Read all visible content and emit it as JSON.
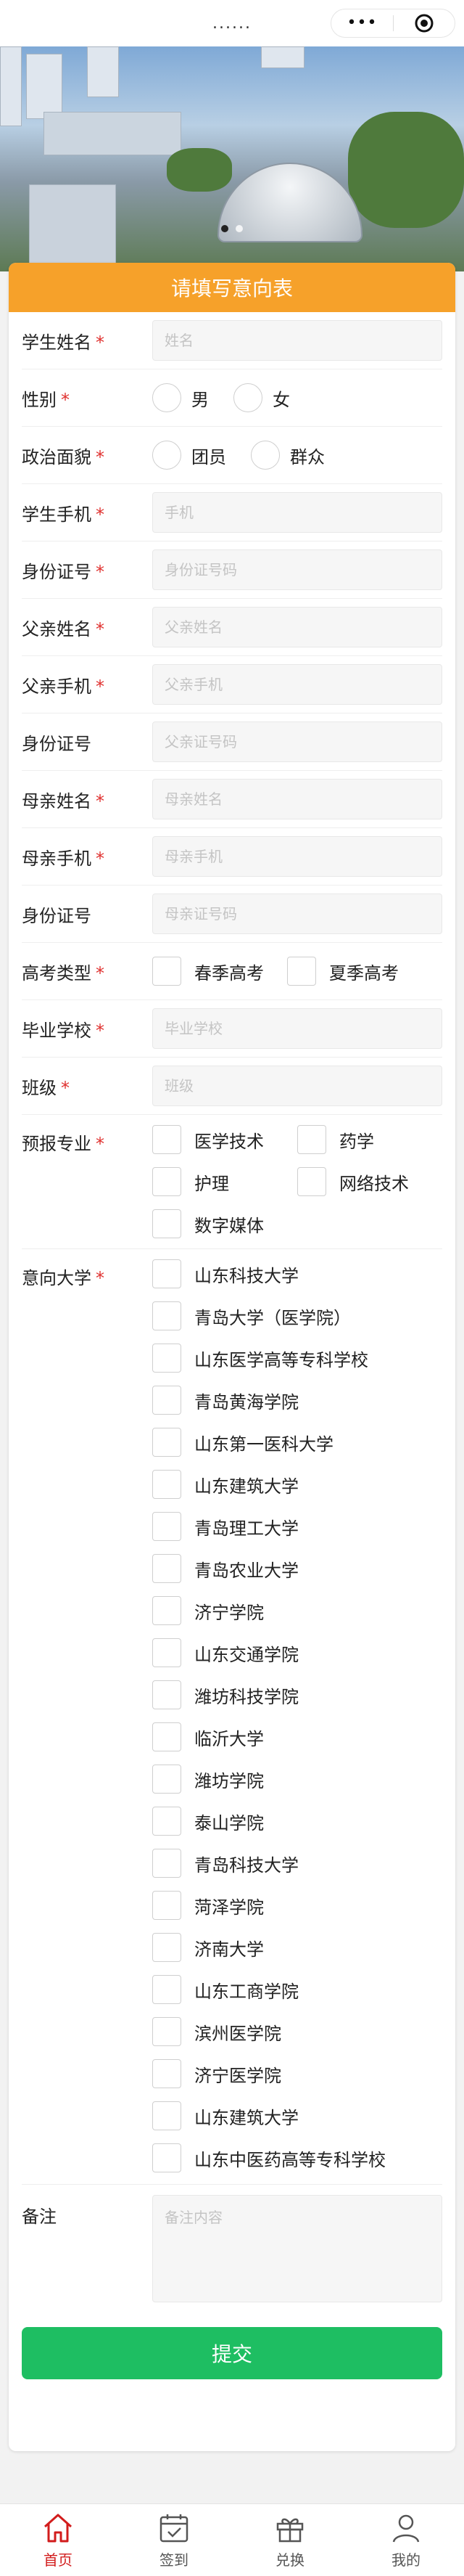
{
  "nav": {
    "title_dots": "......",
    "more_icon": "more-dots-icon",
    "close_icon": "record-circle-icon"
  },
  "banner": {
    "slides": 2,
    "active_slide": 1
  },
  "form": {
    "title": "请填写意向表",
    "required_mark": "*",
    "student_name": {
      "label": "学生姓名",
      "placeholder": "姓名",
      "value": ""
    },
    "gender": {
      "label": "性别",
      "options": [
        "男",
        "女"
      ]
    },
    "political": {
      "label": "政治面貌",
      "options": [
        "团员",
        "群众"
      ]
    },
    "student_phone": {
      "label": "学生手机",
      "placeholder": "手机",
      "value": ""
    },
    "id_card": {
      "label": "身份证号",
      "placeholder": "身份证号码",
      "value": ""
    },
    "father_name": {
      "label": "父亲姓名",
      "placeholder": "父亲姓名",
      "value": ""
    },
    "father_phone": {
      "label": "父亲手机",
      "placeholder": "父亲手机",
      "value": ""
    },
    "father_id": {
      "label": "身份证号",
      "placeholder": "父亲证号码",
      "value": ""
    },
    "mother_name": {
      "label": "母亲姓名",
      "placeholder": "母亲姓名",
      "value": ""
    },
    "mother_phone": {
      "label": "母亲手机",
      "placeholder": "母亲手机",
      "value": ""
    },
    "mother_id": {
      "label": "身份证号",
      "placeholder": "母亲证号码",
      "value": ""
    },
    "exam_type": {
      "label": "高考类型",
      "options": [
        "春季高考",
        "夏季高考"
      ]
    },
    "school": {
      "label": "毕业学校",
      "placeholder": "毕业学校",
      "value": ""
    },
    "class_name": {
      "label": "班级",
      "placeholder": "班级",
      "value": ""
    },
    "major": {
      "label": "预报专业",
      "options": [
        "医学技术",
        "药学",
        "护理",
        "网络技术",
        "数字媒体"
      ]
    },
    "university": {
      "label": "意向大学",
      "options": [
        "山东科技大学",
        "青岛大学（医学院）",
        "山东医学高等专科学校",
        "青岛黄海学院",
        "山东第一医科大学",
        "山东建筑大学",
        "青岛理工大学",
        "青岛农业大学",
        "济宁学院",
        "山东交通学院",
        "潍坊科技学院",
        "临沂大学",
        "潍坊学院",
        "泰山学院",
        "青岛科技大学",
        "菏泽学院",
        "济南大学",
        "山东工商学院",
        "滨州医学院",
        "济宁医学院",
        "山东建筑大学",
        "山东中医药高等专科学校"
      ]
    },
    "remark": {
      "label": "备注",
      "placeholder": "备注内容",
      "value": ""
    },
    "submit_label": "提交"
  },
  "tabbar": {
    "active": 0,
    "items": [
      {
        "label": "首页",
        "icon": "home-icon"
      },
      {
        "label": "签到",
        "icon": "calendar-check-icon"
      },
      {
        "label": "兑换",
        "icon": "gift-icon"
      },
      {
        "label": "我的",
        "icon": "user-icon"
      }
    ]
  },
  "colors": {
    "header": "#f6a12a",
    "submit": "#1ebe62",
    "required": "#e0312f",
    "tab_active": "#d21c1c"
  }
}
